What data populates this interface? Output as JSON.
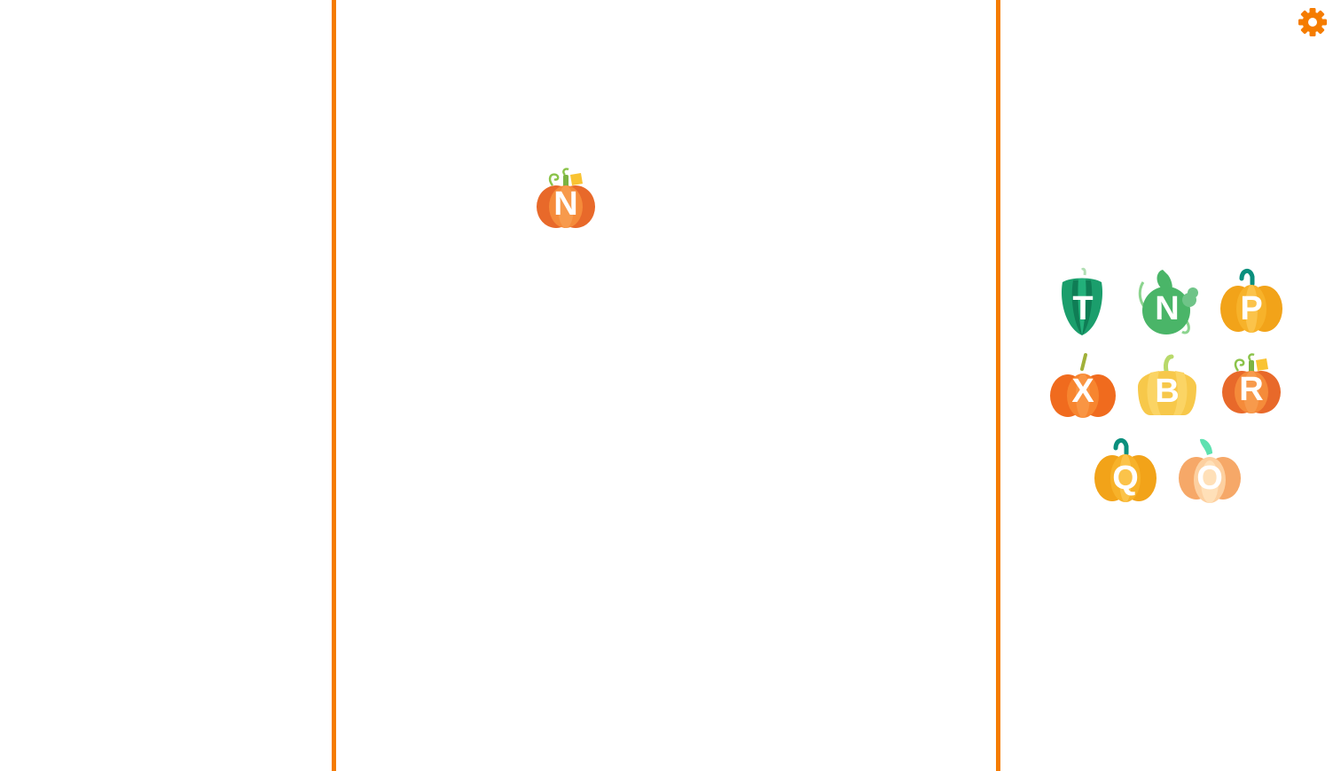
{
  "theme": {
    "divider_color": "#f57c00",
    "gear_color": "#f57c00",
    "letter_color": "#ffffff"
  },
  "settings": {
    "icon": "gear-icon"
  },
  "target_area": {
    "placed": [
      {
        "letter": "N",
        "variant": "orange-leaf-pumpkin"
      }
    ]
  },
  "tray": {
    "pieces": [
      {
        "letter": "T",
        "variant": "green-squash"
      },
      {
        "letter": "N",
        "variant": "green-gourd"
      },
      {
        "letter": "P",
        "variant": "yellow-orange-pumpkin"
      },
      {
        "letter": "X",
        "variant": "orange-pumpkin"
      },
      {
        "letter": "B",
        "variant": "yellow-pumpkin"
      },
      {
        "letter": "R",
        "variant": "orange-leaf-pumpkin"
      },
      {
        "letter": "Q",
        "variant": "yellow-orange-pumpkin"
      },
      {
        "letter": "O",
        "variant": "peach-pumpkin"
      }
    ]
  }
}
